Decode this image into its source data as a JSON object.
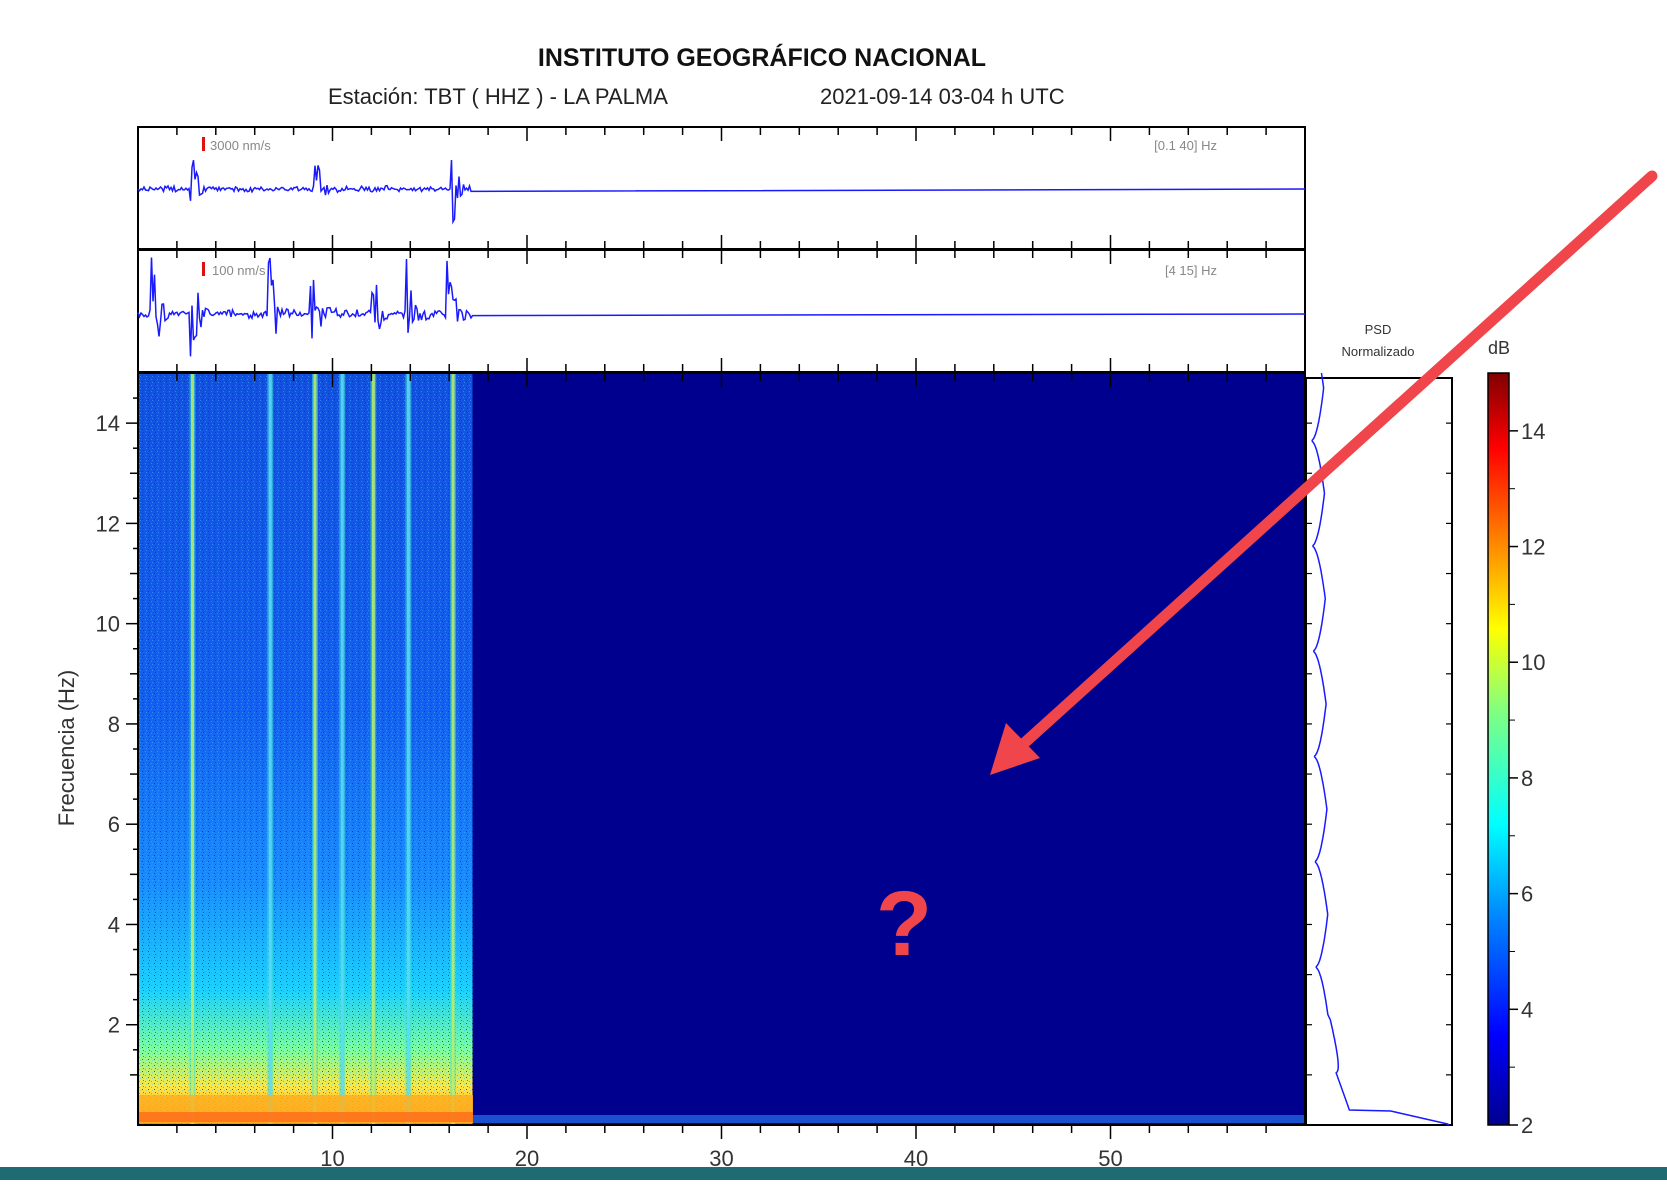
{
  "header": {
    "institution": "INSTITUTO GEOGRÁFICO NACIONAL",
    "station_line": "Estación:  TBT ( HHZ ) - LA PALMA",
    "date_line": "2021-09-14  03-04 h UTC"
  },
  "colors": {
    "trace": "#1a1aff",
    "background_spectrum": "#00008f",
    "annotation": "#f0454b",
    "scale_marker": "#e01010"
  },
  "chart_data": [
    {
      "type": "line",
      "panel": "seismogram-broadband",
      "scale_label": "3000 nm/s",
      "filter_label": "[0.1 40] Hz",
      "signal_end_minute": 17.2,
      "events_minute": [
        2.8,
        9.1,
        16.2
      ],
      "x_range": [
        0,
        60
      ]
    },
    {
      "type": "line",
      "panel": "seismogram-filtered",
      "scale_label": "100 nm/s",
      "filter_label": "[4 15] Hz",
      "signal_end_minute": 17.2,
      "events_minute": [
        0.8,
        2.8,
        6.8,
        9.0,
        12.1,
        13.9,
        16.0
      ],
      "x_range": [
        0,
        60
      ]
    },
    {
      "type": "heatmap",
      "panel": "spectrogram",
      "ylabel": "Frecuencia (Hz)",
      "x_ticks": [
        10,
        20,
        30,
        40,
        50
      ],
      "y_ticks": [
        2,
        4,
        6,
        8,
        10,
        12,
        14
      ],
      "xlim": [
        0,
        60
      ],
      "ylim": [
        0,
        15
      ],
      "signal_end_minute": 17.2,
      "bright_lines_minute": [
        2.8,
        6.8,
        9.1,
        10.5,
        12.1,
        13.9,
        16.2
      ],
      "colorbar": {
        "label": "dB",
        "range": [
          2,
          15
        ],
        "ticks": [
          2,
          4,
          6,
          8,
          10,
          12,
          14
        ],
        "stops": [
          "#00008f",
          "#0000ff",
          "#0080ff",
          "#00ffff",
          "#80ff80",
          "#ffff00",
          "#ff8000",
          "#ff0000",
          "#800000"
        ]
      }
    },
    {
      "type": "line",
      "panel": "psd",
      "title_line1": "PSD",
      "title_line2": "Normalizado",
      "y_range": [
        0,
        15
      ],
      "psd_dips_hz": [
        2.1,
        4.2,
        6.3,
        8.4,
        10.5,
        12.6,
        14.7
      ],
      "psd_end_value": 1.0
    }
  ],
  "annotation": {
    "question_mark": "?",
    "arrow": "pointing from upper right into empty spectrogram area"
  }
}
